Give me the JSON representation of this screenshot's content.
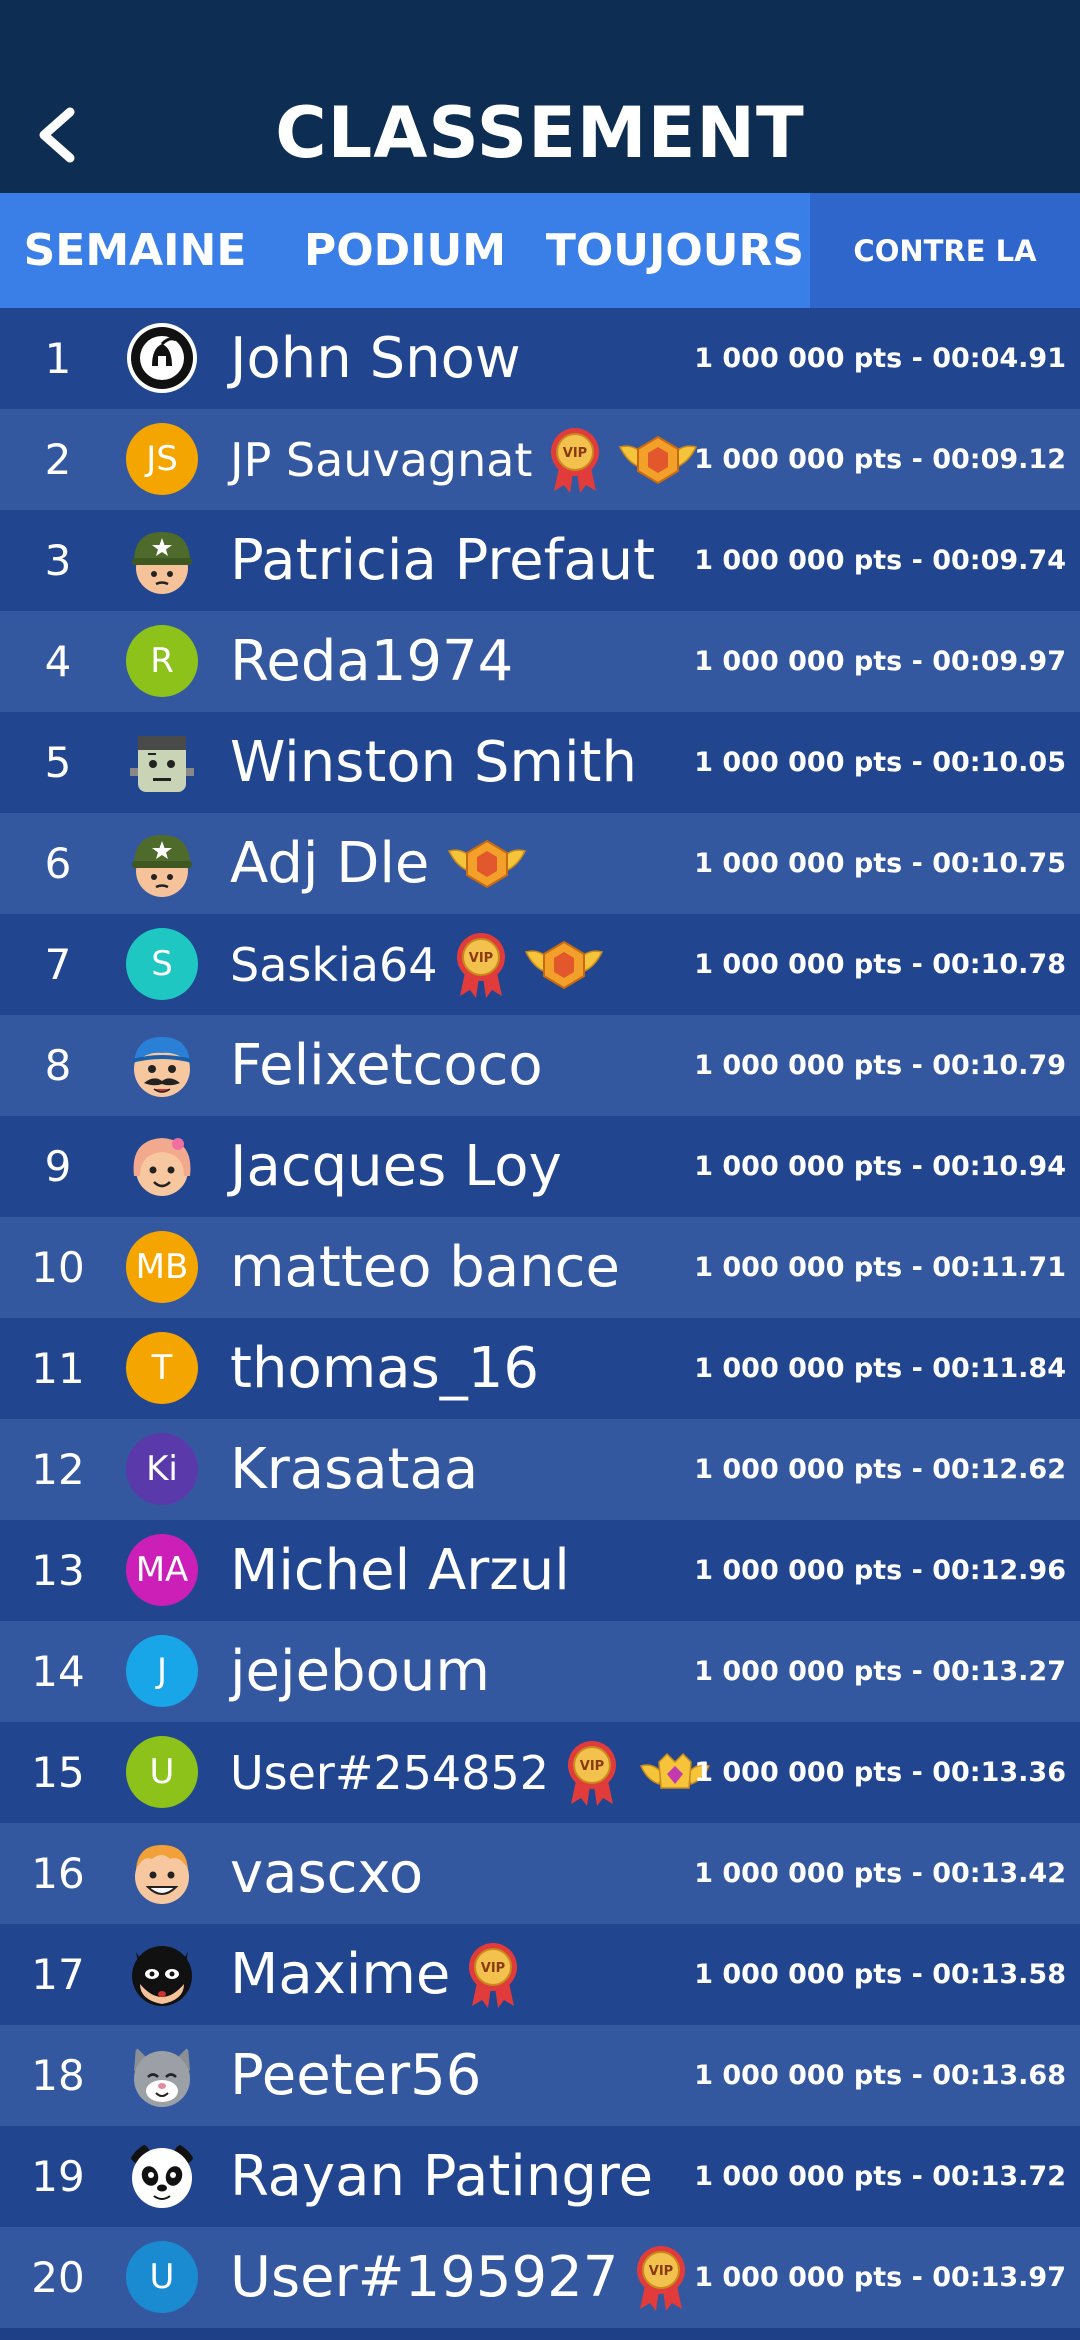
{
  "header": {
    "title": "CLASSEMENT"
  },
  "tabs": [
    {
      "label": "SEMAINE"
    },
    {
      "label": "PODIUM"
    },
    {
      "label": "TOUJOURS"
    },
    {
      "label": "CONTRE LA"
    }
  ],
  "colors": {
    "header_bg": "#0e2d52",
    "tab_bg": "#3a7ee8",
    "active_underline": "#f2913a",
    "row_dark": "#21468f",
    "row_light": "#3458a0"
  },
  "rows": [
    {
      "rank": "1",
      "name": "John Snow",
      "score": "1 000 000 pts - 00:04.91",
      "avatar": {
        "type": "logo",
        "icon": "spartan-logo-icon"
      },
      "badges": []
    },
    {
      "rank": "2",
      "name": "JP Sauvagnat",
      "score": "1 000 000 pts - 00:09.12",
      "avatar": {
        "type": "initials",
        "text": "JS",
        "color": "#f5a500"
      },
      "badges": [
        "vip-medal-icon",
        "gold-wings-emblem-icon"
      ]
    },
    {
      "rank": "3",
      "name": "Patricia Prefaut",
      "score": "1 000 000 pts - 00:09.74",
      "avatar": {
        "type": "face",
        "icon": "soldier-face-icon"
      },
      "badges": []
    },
    {
      "rank": "4",
      "name": "Reda1974",
      "score": "1 000 000 pts - 00:09.97",
      "avatar": {
        "type": "initials",
        "text": "R",
        "color": "#8cc21a"
      },
      "badges": []
    },
    {
      "rank": "5",
      "name": "Winston Smith",
      "score": "1 000 000 pts - 00:10.05",
      "avatar": {
        "type": "face",
        "icon": "frankenstein-face-icon"
      },
      "badges": []
    },
    {
      "rank": "6",
      "name": "Adj Dle",
      "score": "1 000 000 pts - 00:10.75",
      "avatar": {
        "type": "face",
        "icon": "soldier-face-icon"
      },
      "badges": [
        "gold-wings-emblem-icon"
      ]
    },
    {
      "rank": "7",
      "name": "Saskia64",
      "score": "1 000 000 pts - 00:10.78",
      "avatar": {
        "type": "initials",
        "text": "S",
        "color": "#1ec7c1"
      },
      "badges": [
        "vip-medal-icon",
        "gold-wings-emblem-icon"
      ]
    },
    {
      "rank": "8",
      "name": "Felixetcoco",
      "score": "1 000 000 pts - 00:10.79",
      "avatar": {
        "type": "face",
        "icon": "mustache-face-icon"
      },
      "badges": []
    },
    {
      "rank": "9",
      "name": "Jacques Loy",
      "score": "1 000 000 pts - 00:10.94",
      "avatar": {
        "type": "face",
        "icon": "girl-face-icon"
      },
      "badges": []
    },
    {
      "rank": "10",
      "name": "matteo bance",
      "score": "1 000 000 pts - 00:11.71",
      "avatar": {
        "type": "initials",
        "text": "MB",
        "color": "#f5a500"
      },
      "badges": []
    },
    {
      "rank": "11",
      "name": "thomas_16",
      "score": "1 000 000 pts - 00:11.84",
      "avatar": {
        "type": "initials",
        "text": "T",
        "color": "#f5a500"
      },
      "badges": []
    },
    {
      "rank": "12",
      "name": "Krasataa",
      "score": "1 000 000 pts - 00:12.62",
      "avatar": {
        "type": "initials",
        "text": "Ki",
        "color": "#5a3aab"
      },
      "badges": []
    },
    {
      "rank": "13",
      "name": "Michel Arzul",
      "score": "1 000 000 pts - 00:12.96",
      "avatar": {
        "type": "initials",
        "text": "MA",
        "color": "#cc1fb8"
      },
      "badges": []
    },
    {
      "rank": "14",
      "name": "jejeboum",
      "score": "1 000 000 pts - 00:13.27",
      "avatar": {
        "type": "initials",
        "text": "J",
        "color": "#18a6e8"
      },
      "badges": []
    },
    {
      "rank": "15",
      "name": "User#254852",
      "score": "1 000 000 pts - 00:13.36",
      "avatar": {
        "type": "initials",
        "text": "U",
        "color": "#8cc21a"
      },
      "badges": [
        "vip-medal-icon",
        "crown-emblem-icon"
      ]
    },
    {
      "rank": "16",
      "name": "vascxo",
      "score": "1 000 000 pts - 00:13.42",
      "avatar": {
        "type": "face",
        "icon": "boy-face-icon"
      },
      "badges": []
    },
    {
      "rank": "17",
      "name": "Maxime",
      "score": "1 000 000 pts - 00:13.58",
      "avatar": {
        "type": "face",
        "icon": "masked-hero-face-icon"
      },
      "badges": [
        "vip-medal-icon"
      ]
    },
    {
      "rank": "18",
      "name": "Peeter56",
      "score": "1 000 000 pts - 00:13.68",
      "avatar": {
        "type": "face",
        "icon": "cat-face-icon"
      },
      "badges": []
    },
    {
      "rank": "19",
      "name": "Rayan Patingre",
      "score": "1 000 000 pts - 00:13.72",
      "avatar": {
        "type": "face",
        "icon": "panda-face-icon"
      },
      "badges": []
    },
    {
      "rank": "20",
      "name": "User#195927",
      "score": "1 000 000 pts - 00:13.97",
      "avatar": {
        "type": "initials",
        "text": "U",
        "color": "#1a8bd0"
      },
      "badges": [
        "vip-medal-icon"
      ]
    }
  ]
}
